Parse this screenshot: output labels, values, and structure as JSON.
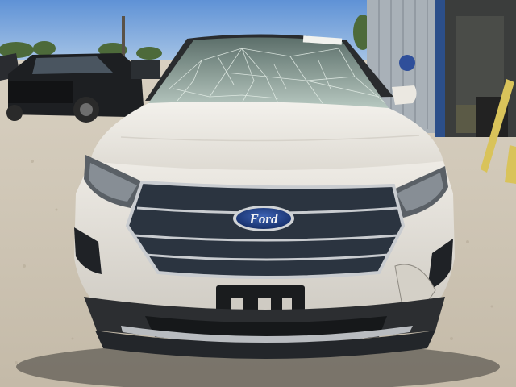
{
  "photo": {
    "brand_badge": "Ford",
    "colors": {
      "sky": "#6f9fd8",
      "ground": "#cfc6b6",
      "body": "#e9e6df",
      "grille": "#2b3440",
      "chrome": "#c9ccd0",
      "badge_blue": "#1f3f86",
      "glass": "#8fa79e",
      "truck": "#1d1f22",
      "building": "#a9b1b8",
      "post": "#d9c35a"
    }
  }
}
